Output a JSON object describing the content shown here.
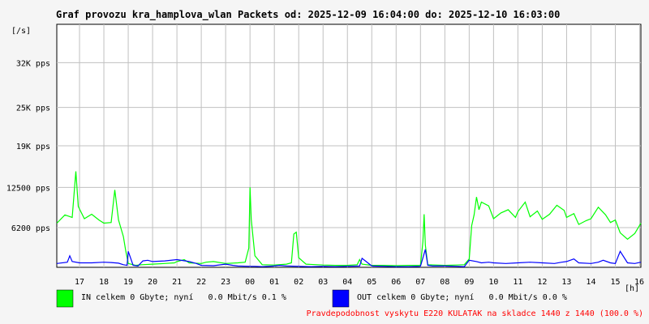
{
  "chart_data": {
    "type": "area",
    "title": "Graf provozu kra_hamplova_wlan Packets od: 2025-12-09 16:04:00 do: 2025-12-10 16:03:00",
    "ylabel": "[/s]",
    "xlabel": "[h]",
    "ylim": [
      0,
      38000
    ],
    "x_hour_range": [
      16.0667,
      40.05
    ],
    "y_ticks": [
      {
        "value": 6200,
        "label": "6200 pps"
      },
      {
        "value": 12500,
        "label": "12500 pps"
      },
      {
        "value": 19000,
        "label": "19K pps"
      },
      {
        "value": 25000,
        "label": "25K pps"
      },
      {
        "value": 32000,
        "label": "32K pps"
      }
    ],
    "x_ticks": [
      {
        "hour": 17,
        "label": "17"
      },
      {
        "hour": 18,
        "label": "18"
      },
      {
        "hour": 19,
        "label": "19"
      },
      {
        "hour": 20,
        "label": "20"
      },
      {
        "hour": 21,
        "label": "21"
      },
      {
        "hour": 22,
        "label": "22"
      },
      {
        "hour": 23,
        "label": "23"
      },
      {
        "hour": 24,
        "label": "00"
      },
      {
        "hour": 25,
        "label": "01"
      },
      {
        "hour": 26,
        "label": "02"
      },
      {
        "hour": 27,
        "label": "03"
      },
      {
        "hour": 28,
        "label": "04"
      },
      {
        "hour": 29,
        "label": "05"
      },
      {
        "hour": 30,
        "label": "06"
      },
      {
        "hour": 31,
        "label": "07"
      },
      {
        "hour": 32,
        "label": "08"
      },
      {
        "hour": 33,
        "label": "09"
      },
      {
        "hour": 34,
        "label": "10"
      },
      {
        "hour": 35,
        "label": "11"
      },
      {
        "hour": 36,
        "label": "12"
      },
      {
        "hour": 37,
        "label": "13"
      },
      {
        "hour": 38,
        "label": "14"
      },
      {
        "hour": 39,
        "label": "15"
      },
      {
        "hour": 40,
        "label": "16"
      }
    ],
    "grid": true,
    "series": [
      {
        "key": "in",
        "color": "#00ff00",
        "x": [
          16.07,
          16.4,
          16.7,
          16.85,
          16.95,
          17.2,
          17.5,
          17.8,
          18.0,
          18.3,
          18.45,
          18.6,
          18.8,
          18.9,
          19.0,
          19.3,
          19.55,
          20.0,
          20.5,
          20.9,
          21.0,
          21.3,
          21.5,
          22.0,
          22.2,
          22.5,
          23.0,
          23.5,
          23.8,
          23.95,
          24.0,
          24.05,
          24.2,
          24.5,
          25.0,
          25.5,
          25.7,
          25.8,
          25.9,
          26.0,
          26.3,
          27.0,
          27.5,
          28.0,
          28.4,
          28.5,
          28.6,
          29.0,
          29.5,
          30.0,
          30.5,
          31.0,
          31.1,
          31.15,
          31.2,
          31.3,
          32.0,
          32.5,
          32.8,
          33.0,
          33.1,
          33.2,
          33.3,
          33.4,
          33.5,
          33.8,
          34.0,
          34.3,
          34.6,
          34.9,
          35.0,
          35.3,
          35.5,
          35.8,
          36.0,
          36.3,
          36.6,
          36.9,
          37.0,
          37.3,
          37.5,
          37.8,
          38.0,
          38.3,
          38.6,
          38.8,
          39.0,
          39.2,
          39.5,
          39.8,
          40.05
        ],
        "values": [
          6900,
          8200,
          7800,
          15000,
          9500,
          7600,
          8300,
          7400,
          6900,
          7000,
          12100,
          7400,
          4800,
          2500,
          600,
          300,
          400,
          500,
          600,
          700,
          900,
          1200,
          700,
          600,
          800,
          900,
          600,
          700,
          800,
          3000,
          12500,
          7500,
          1800,
          400,
          350,
          500,
          700,
          5200,
          5500,
          1500,
          500,
          350,
          300,
          300,
          400,
          1200,
          500,
          300,
          300,
          250,
          300,
          300,
          4000,
          8300,
          3500,
          400,
          300,
          350,
          400,
          1300,
          6500,
          8200,
          11000,
          9000,
          10200,
          9600,
          7600,
          8500,
          9000,
          7800,
          8700,
          10200,
          7900,
          8800,
          7500,
          8300,
          9700,
          8900,
          7800,
          8400,
          6700,
          7300,
          7600,
          9400,
          8200,
          7000,
          7400,
          5400,
          4400,
          5300,
          6900
        ]
      },
      {
        "key": "out",
        "color": "#0000ff",
        "x": [
          16.07,
          16.5,
          16.6,
          16.7,
          17.0,
          17.5,
          18.0,
          18.3,
          18.6,
          18.8,
          18.95,
          19.0,
          19.2,
          19.4,
          19.6,
          19.8,
          20.0,
          20.5,
          21.0,
          21.5,
          21.8,
          22.0,
          22.5,
          23.0,
          23.3,
          23.5,
          24.0,
          24.2,
          24.5,
          25.0,
          25.2,
          25.5,
          26.0,
          26.5,
          27.0,
          27.5,
          28.0,
          28.5,
          28.6,
          29.0,
          29.5,
          30.0,
          30.5,
          31.0,
          31.2,
          31.3,
          31.5,
          32.0,
          32.5,
          32.8,
          33.0,
          33.3,
          33.5,
          33.8,
          34.0,
          34.5,
          35.0,
          35.5,
          36.0,
          36.5,
          36.8,
          37.0,
          37.3,
          37.5,
          38.0,
          38.3,
          38.5,
          38.8,
          39.0,
          39.2,
          39.5,
          39.8,
          40.05
        ],
        "values": [
          600,
          800,
          1800,
          900,
          700,
          700,
          800,
          750,
          650,
          400,
          300,
          2500,
          300,
          200,
          1000,
          1100,
          900,
          1000,
          1200,
          900,
          600,
          300,
          250,
          500,
          300,
          200,
          150,
          150,
          100,
          200,
          300,
          200,
          150,
          100,
          150,
          100,
          150,
          200,
          1400,
          200,
          150,
          100,
          100,
          150,
          2800,
          300,
          200,
          200,
          150,
          100,
          1100,
          900,
          700,
          800,
          700,
          600,
          700,
          800,
          700,
          600,
          800,
          900,
          1300,
          700,
          600,
          800,
          1100,
          700,
          600,
          2500,
          700,
          600,
          800
        ]
      }
    ],
    "legend": [
      {
        "color": "#00ff00",
        "label": "IN celkem 0 Gbyte; nyní   0.0 Mbit/s 0.1 %"
      },
      {
        "color": "#0000ff",
        "label": "OUT celkem 0 Gbyte; nyní   0.0 Mbit/s 0.0 %"
      }
    ],
    "footer": "Pravdepodobnost vyskytu E220 KULATAK na skladce 1440 z 1440 (100.0 %)",
    "footer_color": "#ff0000"
  }
}
